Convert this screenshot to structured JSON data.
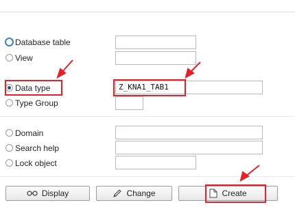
{
  "object_types": [
    {
      "label": "Database table",
      "selected": false
    },
    {
      "label": "View",
      "selected": false
    },
    {
      "label": "Data type",
      "selected": true,
      "value": "Z_KNA1_TAB1"
    },
    {
      "label": "Type Group",
      "selected": false
    },
    {
      "label": "Domain",
      "selected": false
    },
    {
      "label": "Search help",
      "selected": false
    },
    {
      "label": "Lock object",
      "selected": false
    }
  ],
  "buttons": {
    "display": "Display",
    "change": "Change",
    "create": "Create"
  },
  "icons": {
    "display": "glasses-icon",
    "change": "pencil-icon",
    "create": "document-icon"
  },
  "colors": {
    "highlight": "#e81f24",
    "radio_focus": "#3b7fc4"
  }
}
